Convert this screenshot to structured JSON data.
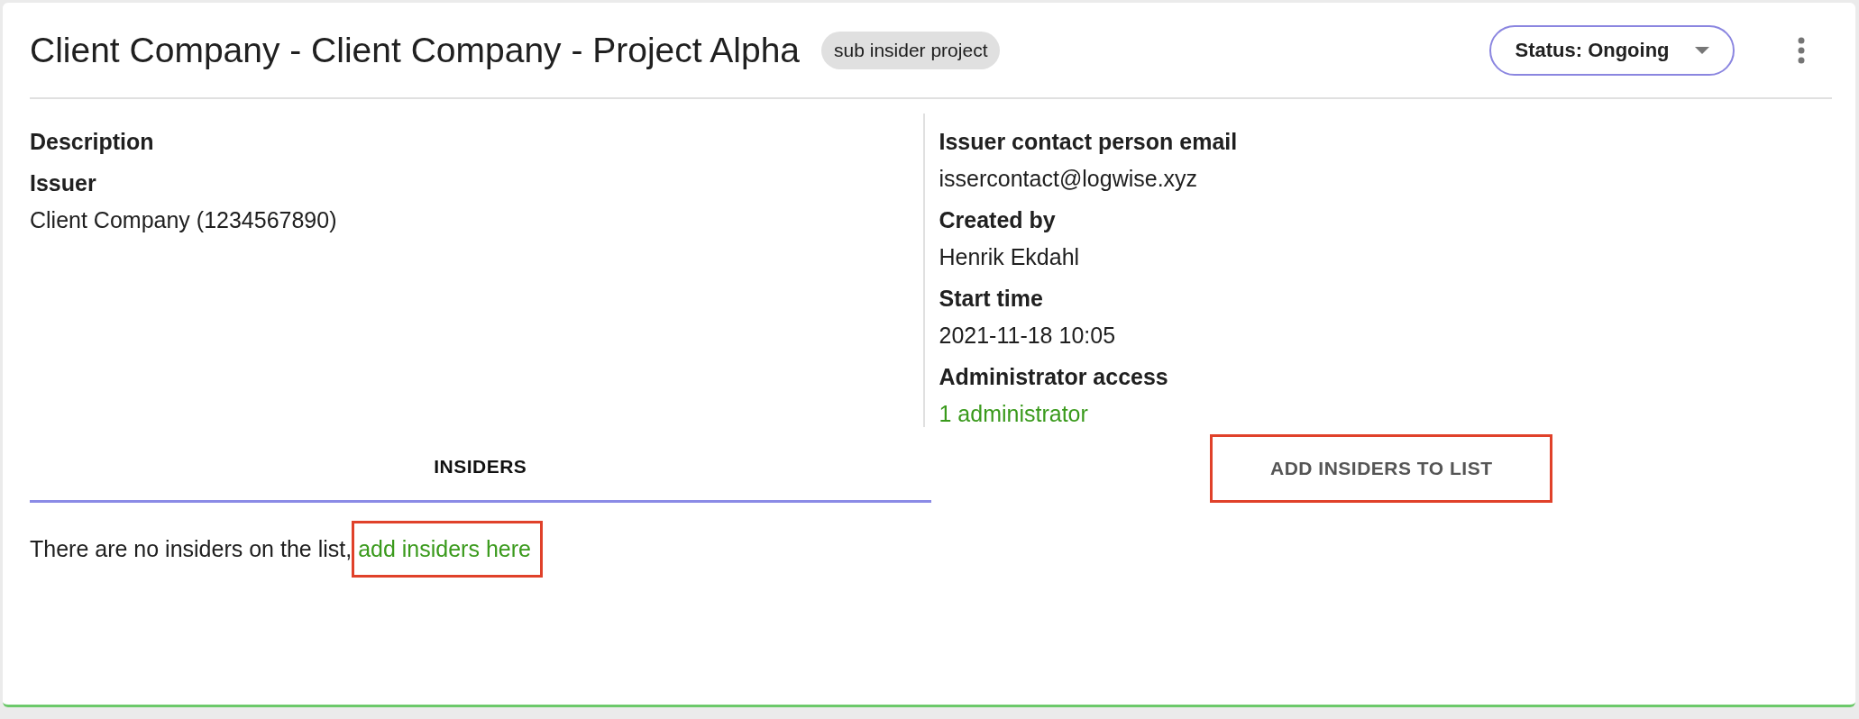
{
  "header": {
    "title": "Client Company - Client Company - Project Alpha",
    "badge": "sub insider project",
    "status": "Status: Ongoing"
  },
  "left_fields": [
    {
      "label": "Description"
    },
    {
      "label": "Issuer",
      "value": "Client Company (1234567890)"
    }
  ],
  "right_fields": [
    {
      "label": "Issuer contact person email",
      "value": "issercontact@logwise.xyz",
      "kind": "text"
    },
    {
      "label": "Created by",
      "value": "Henrik Ekdahl",
      "kind": "text"
    },
    {
      "label": "Start time",
      "value": "2021-11-18 10:05",
      "kind": "text"
    },
    {
      "label": "Administrator access",
      "value": "1 administrator",
      "kind": "link"
    }
  ],
  "tabs": [
    {
      "label": "INSIDERS",
      "selected": true,
      "highlighted": false
    },
    {
      "label": "ADD INSIDERS TO LIST",
      "selected": false,
      "highlighted": true
    }
  ],
  "empty_message": {
    "text": "There are no insiders on the list,",
    "link": "add insiders here",
    "link_highlighted": true
  }
}
